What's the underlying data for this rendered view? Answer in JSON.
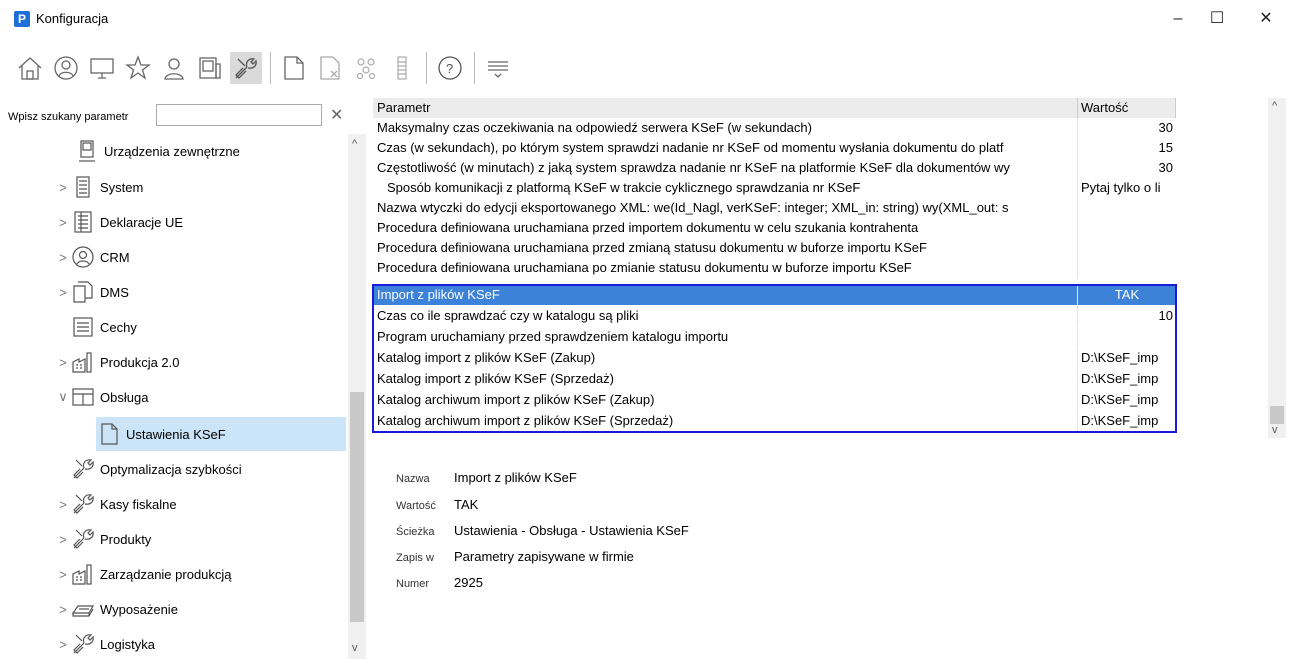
{
  "window": {
    "title": "Konfiguracja",
    "app_icon": "P"
  },
  "toolbar": {
    "buttons": [
      {
        "icon": "home-icon"
      },
      {
        "icon": "user-circle-icon"
      },
      {
        "icon": "monitor-icon"
      },
      {
        "icon": "star-icon"
      },
      {
        "icon": "user-icon"
      },
      {
        "icon": "device-icon"
      },
      {
        "icon": "tools-icon",
        "active": true
      },
      {
        "icon": "document-icon"
      },
      {
        "icon": "document-delete-icon"
      },
      {
        "icon": "people-group-icon"
      },
      {
        "icon": "list-icon"
      },
      {
        "icon": "help-icon"
      },
      {
        "icon": "filter-icon"
      }
    ]
  },
  "search": {
    "label": "Wpisz szukany parametr",
    "value": "",
    "placeholder": ""
  },
  "tree": [
    {
      "label": "Urządzenia zewnętrzne",
      "icon": "device-icon",
      "expander": ""
    },
    {
      "label": "System",
      "icon": "list-icon",
      "expander": ">"
    },
    {
      "label": "Deklaracje UE",
      "icon": "ledger-icon",
      "expander": ">"
    },
    {
      "label": "CRM",
      "icon": "user-circle-icon",
      "expander": ">"
    },
    {
      "label": "DMS",
      "icon": "documents-icon",
      "expander": ">"
    },
    {
      "label": "Cechy",
      "icon": "text-lines-icon",
      "expander": ""
    },
    {
      "label": "Produkcja 2.0",
      "icon": "factory-icon",
      "expander": ">"
    },
    {
      "label": "Obsługa",
      "icon": "table-icon",
      "expander": "∨"
    },
    {
      "label": "Ustawienia KSeF",
      "icon": "document-icon",
      "expander": ""
    },
    {
      "label": "Optymalizacja szybkości",
      "icon": "tools-icon",
      "expander": ""
    },
    {
      "label": "Kasy fiskalne",
      "icon": "tools-icon",
      "expander": ">"
    },
    {
      "label": "Produkty",
      "icon": "tools-icon",
      "expander": ">"
    },
    {
      "label": "Zarządzanie produkcją",
      "icon": "factory-icon",
      "expander": ">"
    },
    {
      "label": "Wyposażenie",
      "icon": "keyboard-icon",
      "expander": ">"
    },
    {
      "label": "Logistyka",
      "icon": "tools-icon",
      "expander": ">"
    }
  ],
  "grid": {
    "headers": {
      "param": "Parametr",
      "value": "Wartość"
    },
    "rows": [
      {
        "param": "Maksymalny czas oczekiwania na odpowiedź serwera KSeF (w sekundach)",
        "value": "30",
        "num": true
      },
      {
        "param": "Czas (w sekundach), po którym system sprawdzi nadanie nr KSeF od momentu wysłania dokumentu do platf",
        "value": "15",
        "num": true
      },
      {
        "param": "Częstotliwość (w minutach) z jaką system sprawdza nadanie nr KSeF na platformie KSeF dla dokumentów wy",
        "value": "30",
        "num": true
      },
      {
        "param": "Sposób komunikacji z platformą KSeF w trakcie cyklicznego sprawdzania nr KSeF",
        "value": "Pytaj tylko o li",
        "indent": true
      },
      {
        "param": "Nazwa wtyczki do edycji eksportowanego XML: we(Id_Nagl, verKSeF: integer; XML_in: string) wy(XML_out: s",
        "value": ""
      },
      {
        "param": "Procedura definiowana uruchamiana przed importem dokumentu w celu szukania kontrahenta",
        "value": ""
      },
      {
        "param": "Procedura definiowana uruchamiana przed zmianą statusu dokumentu w buforze importu KSeF",
        "value": ""
      },
      {
        "param": "Procedura definiowana uruchamiana po zmianie statusu dokumentu w buforze importu KSeF",
        "value": ""
      },
      {
        "param": "Import z plików KSeF",
        "value": "TAK",
        "selected": true
      },
      {
        "param": "Czas co ile sprawdzać czy w katalogu są pliki",
        "value": "10",
        "num": true
      },
      {
        "param": "Program uruchamiany przed sprawdzeniem katalogu importu",
        "value": ""
      },
      {
        "param": "Katalog import z plików KSeF (Zakup)",
        "value": "D:\\KSeF_imp"
      },
      {
        "param": "Katalog import z plików KSeF (Sprzedaż)",
        "value": "D:\\KSeF_imp"
      },
      {
        "param": "Katalog archiwum import z plików KSeF (Zakup)",
        "value": "D:\\KSeF_imp"
      },
      {
        "param": "Katalog archiwum import z plików KSeF (Sprzedaż)",
        "value": "D:\\KSeF_imp"
      }
    ]
  },
  "details": [
    {
      "label": "Nazwa",
      "value": "Import z plików KSeF"
    },
    {
      "label": "Wartość",
      "value": "TAK"
    },
    {
      "label": "Ścieżka",
      "value": "Ustawienia - Obsługa - Ustawienia KSeF"
    },
    {
      "label": "Zapis w",
      "value": "Parametry zapisywane w firmie"
    },
    {
      "label": "Numer",
      "value": "2925"
    }
  ],
  "colors": {
    "selection": "#3d82d9",
    "highlight_border": "#1a1adc",
    "tree_selection": "#cce4f7"
  }
}
